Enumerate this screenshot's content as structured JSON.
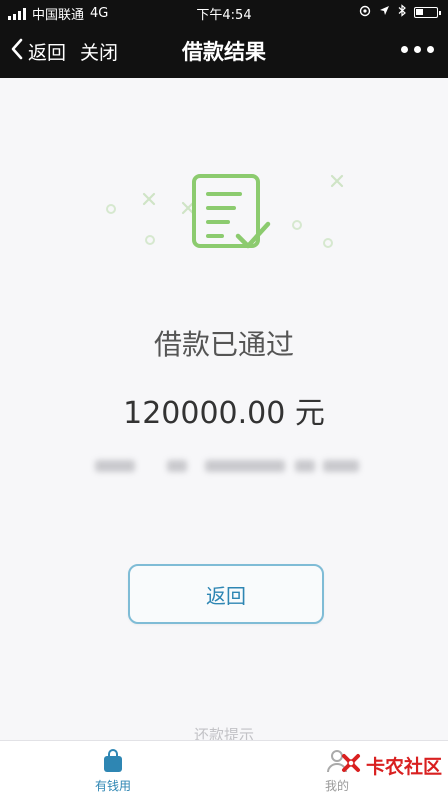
{
  "status_bar": {
    "carrier": "中国联通",
    "network": "4G",
    "time": "下午4:54"
  },
  "nav": {
    "back_label": "返回",
    "close_label": "关闭",
    "title": "借款结果"
  },
  "result": {
    "title": "借款已通过",
    "amount": "120000.00 元"
  },
  "actions": {
    "back_button": "返回"
  },
  "footer_tip": "还款提示",
  "tabs": [
    {
      "label": "有钱用",
      "icon": "shopping-bag-icon",
      "active": true
    },
    {
      "label": "我的",
      "icon": "person-icon",
      "active": false
    }
  ],
  "watermark": "卡农社区",
  "colors": {
    "accent": "#2e86b3",
    "success_green": "#8ccb6f",
    "nav_background": "#111111"
  }
}
